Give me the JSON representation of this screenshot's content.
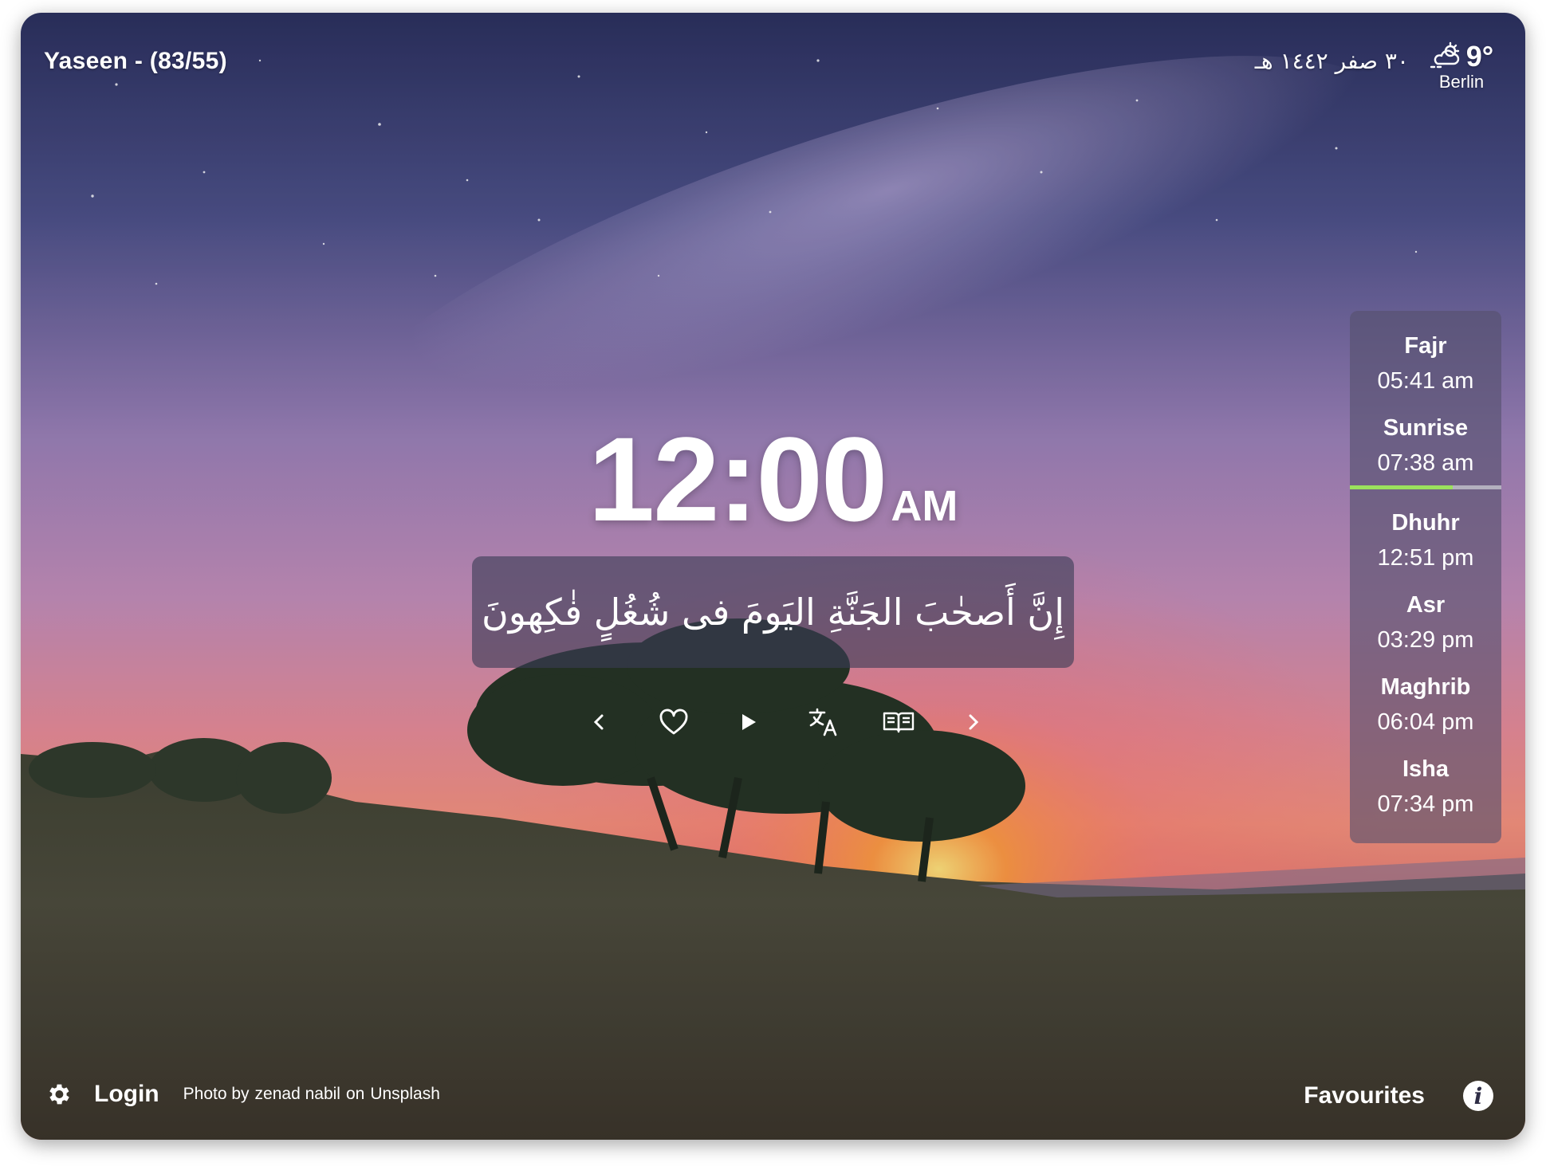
{
  "header": {
    "surah_label": "Yaseen - (83/55)",
    "hijri_date": "٣٠ صفر ١٤٤٢ هـ",
    "weather": {
      "temperature": "9°",
      "city": "Berlin",
      "icon": "cloud-sun-icon"
    }
  },
  "clock": {
    "time": "12:00",
    "period": "AM"
  },
  "verse": {
    "arabic": "إِنَّ أَصحٰبَ الجَنَّةِ اليَومَ فى شُغُلٍ فٰكِهونَ"
  },
  "controls": {
    "icons": [
      "chevron-left-icon",
      "heart-icon",
      "play-icon",
      "translate-icon",
      "book-open-icon",
      "chevron-right-icon"
    ]
  },
  "prayer_times": {
    "items": [
      {
        "name": "Fajr",
        "time": "05:41 am"
      },
      {
        "name": "Sunrise",
        "time": "07:38 am"
      },
      {
        "name": "Dhuhr",
        "time": "12:51 pm"
      },
      {
        "name": "Asr",
        "time": "03:29 pm"
      },
      {
        "name": "Maghrib",
        "time": "06:04 pm"
      },
      {
        "name": "Isha",
        "time": "07:34 pm"
      }
    ],
    "progress_fraction": 0.68,
    "progress_color": "#9be15d"
  },
  "footer": {
    "login_label": "Login",
    "credit_prefix": "Photo by",
    "credit_author": "zenad nabil",
    "credit_on": "on",
    "credit_site": "Unsplash",
    "favourites_label": "Favourites",
    "info_glyph": "i"
  }
}
